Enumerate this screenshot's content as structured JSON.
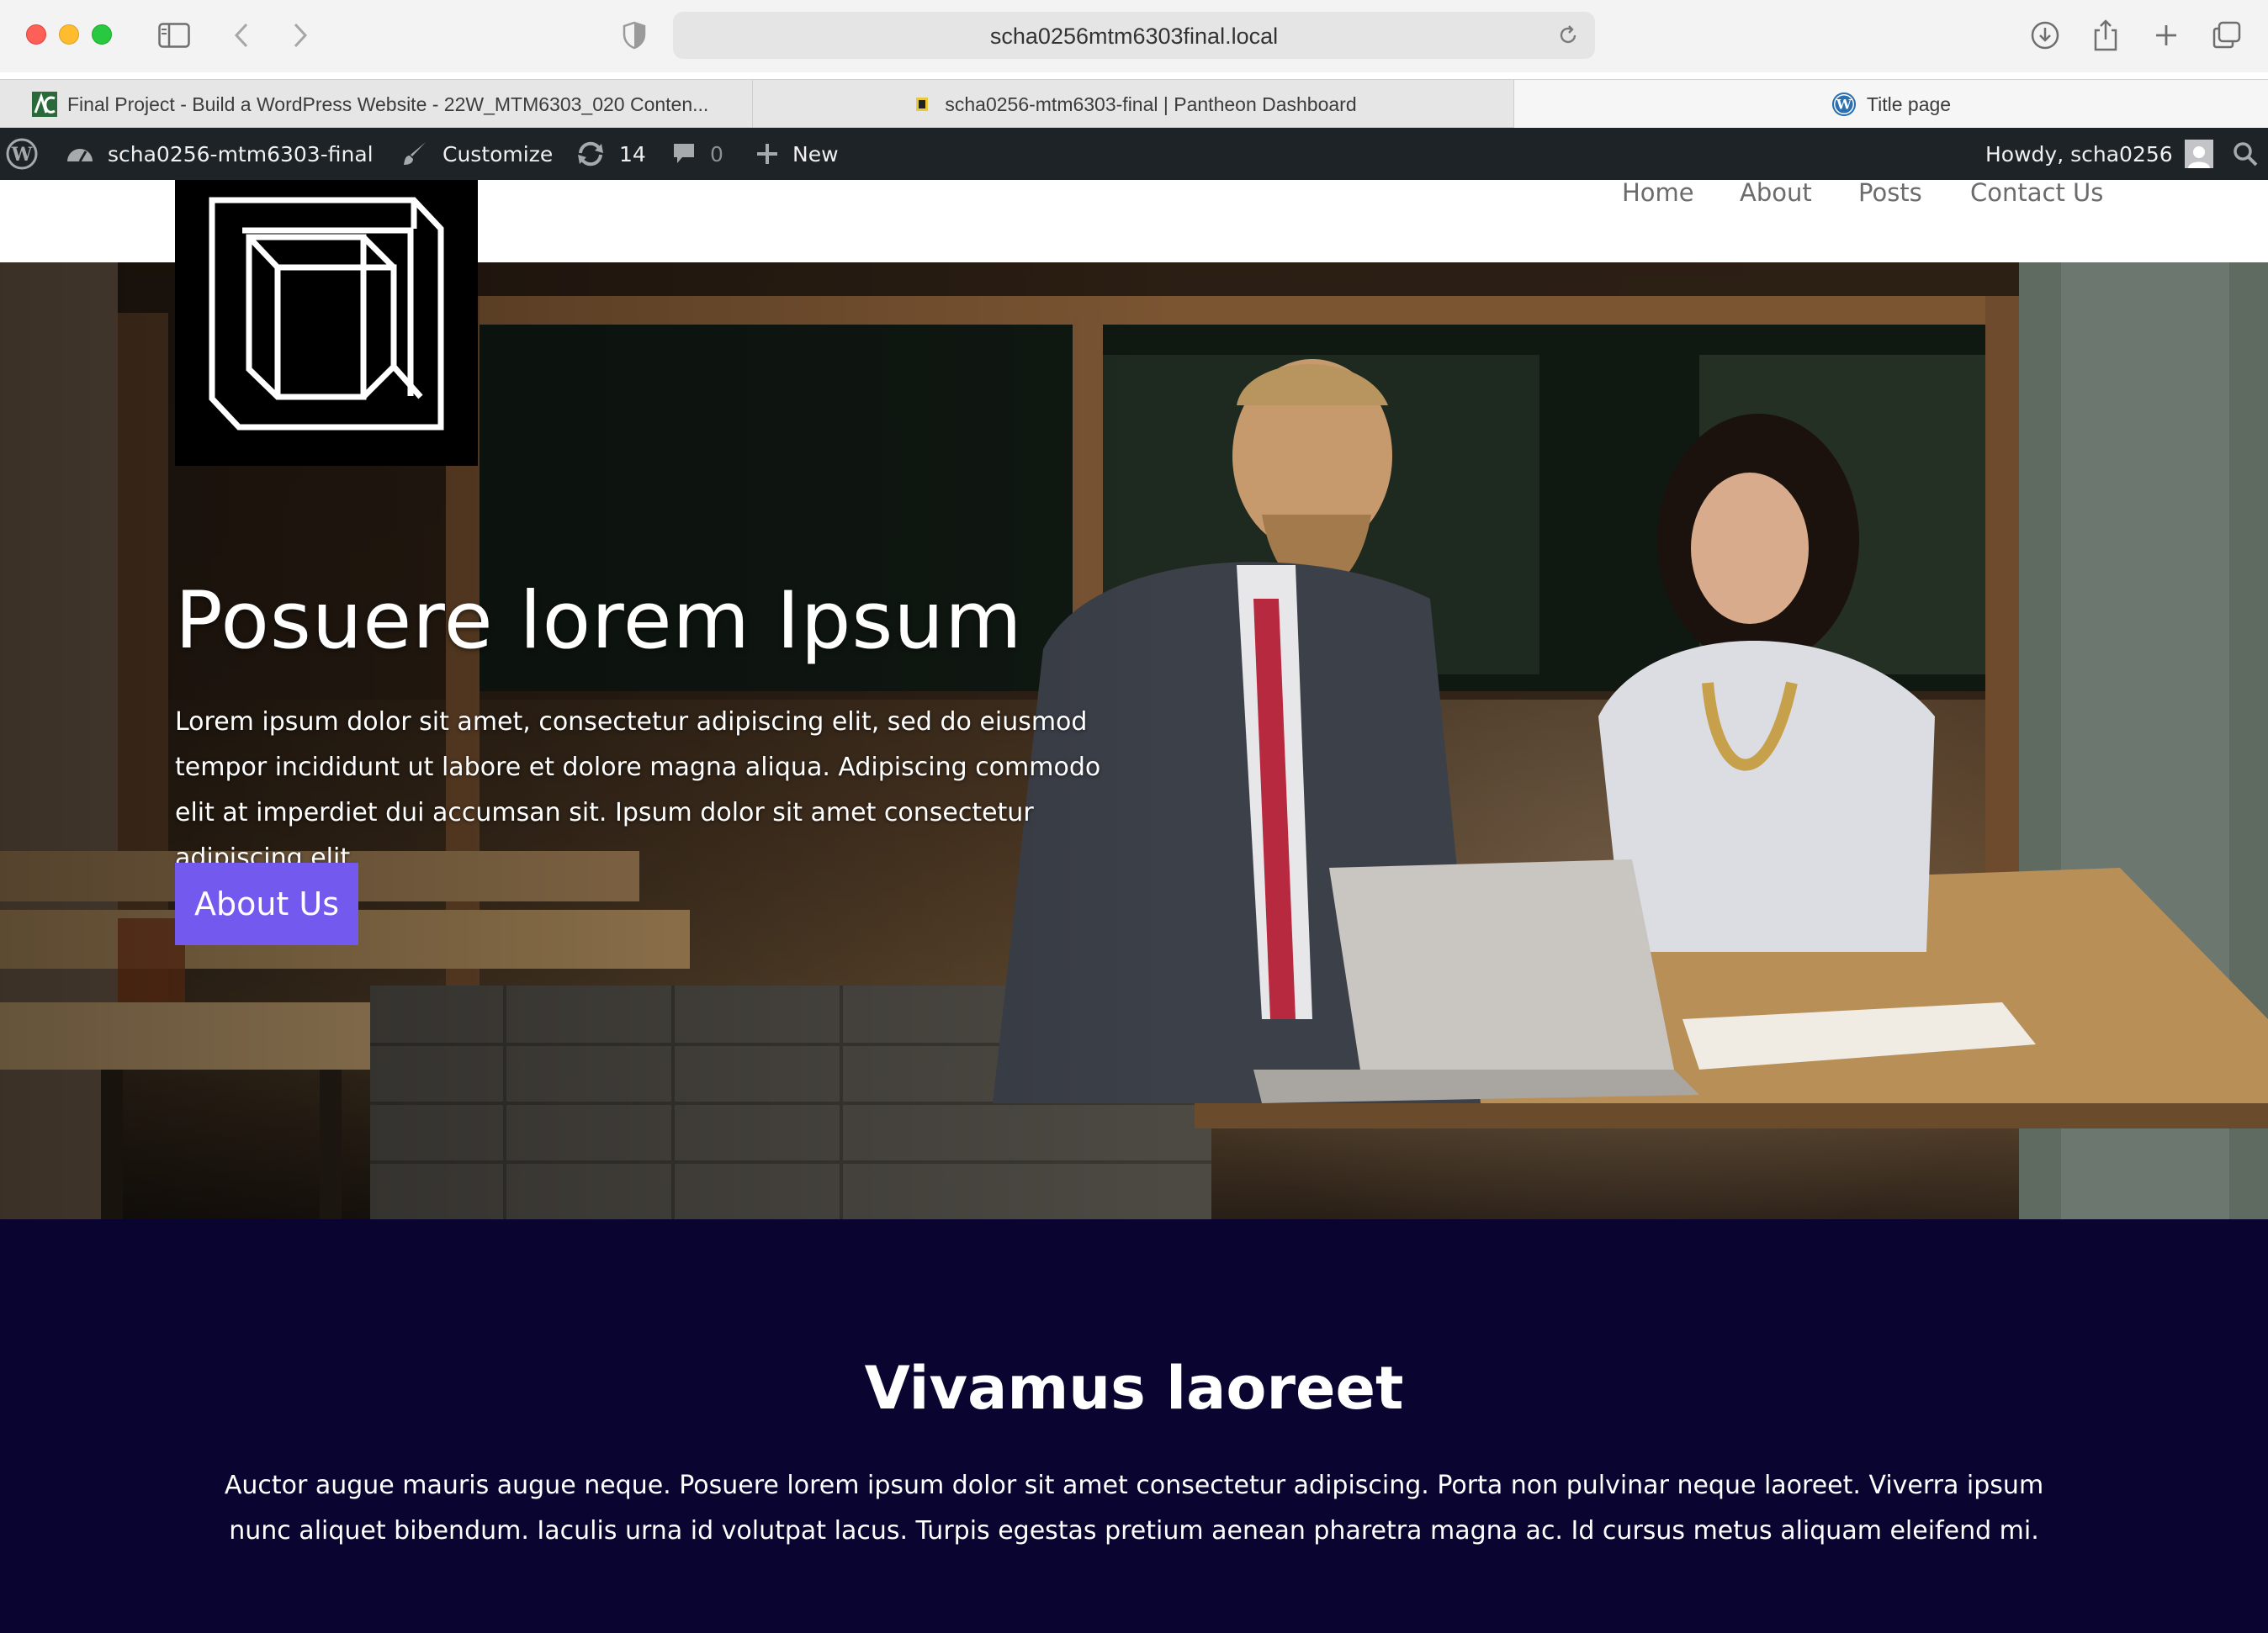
{
  "browser": {
    "url": "scha0256mtm6303final.local",
    "tabs": [
      {
        "label": "Final Project - Build a WordPress Website - 22W_MTM6303_020 Conten..."
      },
      {
        "label": "scha0256-mtm6303-final | Pantheon Dashboard"
      },
      {
        "label": "Title page"
      }
    ]
  },
  "adminbar": {
    "site_name": "scha0256-mtm6303-final",
    "customize": "Customize",
    "updates_count": "14",
    "comments_count": "0",
    "new_label": "New",
    "howdy": "Howdy, scha0256"
  },
  "nav": {
    "items": [
      "Home",
      "About",
      "Posts",
      "Contact Us"
    ]
  },
  "hero": {
    "title": "Posuere lorem Ipsum",
    "text": "Lorem ipsum dolor sit amet, consectetur adipiscing elit, sed do eiusmod tempor incididunt ut labore et dolore magna aliqua. Adipiscing commodo elit at imperdiet dui accumsan sit. Ipsum dolor sit amet consectetur adipiscing elit.",
    "button": "About Us"
  },
  "section": {
    "title": "Vivamus laoreet",
    "text": "Auctor augue mauris augue neque. Posuere lorem ipsum dolor sit amet consectetur adipiscing. Porta non pulvinar neque laoreet. Viverra ipsum nunc aliquet bibendum. Iaculis urna id volutpat lacus. Turpis egestas pretium aenean pharetra magna ac. Id cursus metus aliquam eleifend mi."
  },
  "colors": {
    "accent_button": "#7459ef",
    "dark_section": "#0a0530",
    "adminbar": "#1d2327"
  }
}
